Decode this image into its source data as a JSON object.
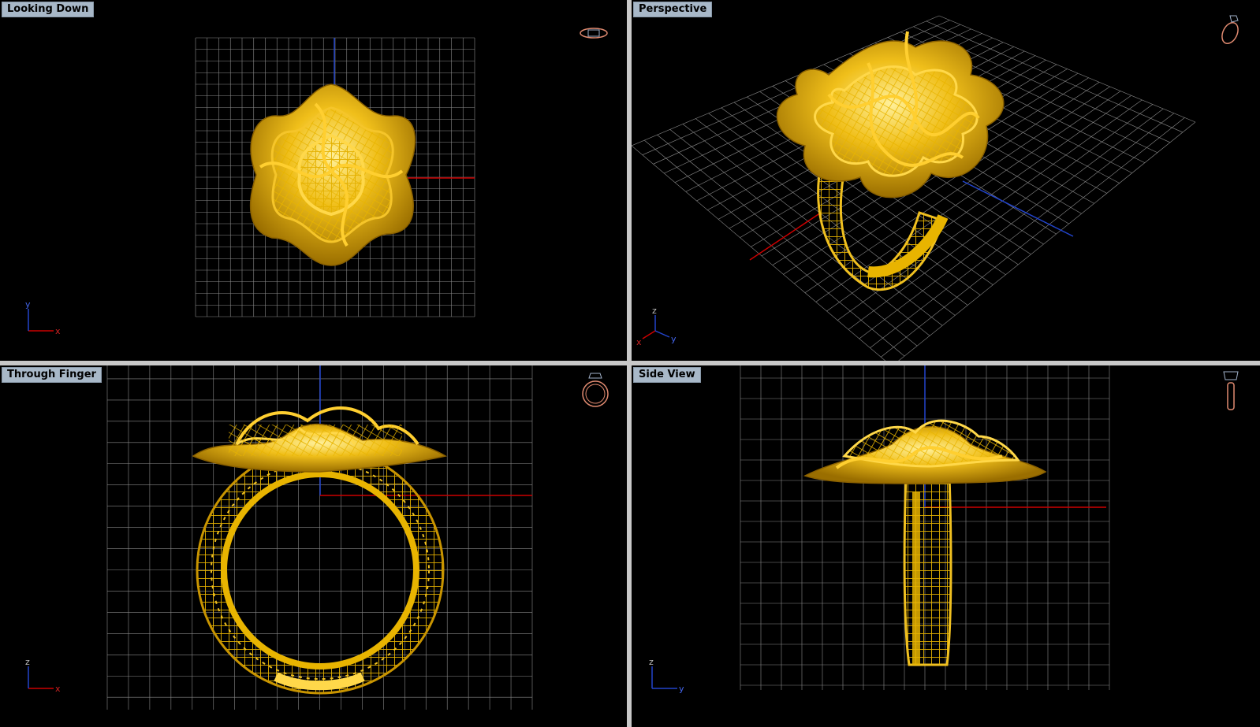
{
  "viewports": [
    {
      "id": "top",
      "title": "Looking Down",
      "axis_x": "x",
      "axis_y": "y",
      "icon": "ring-top-view-icon"
    },
    {
      "id": "perspective",
      "title": "Perspective",
      "axis_x": "y",
      "axis_y": "z",
      "axis_third": "x",
      "icon": "ring-perspective-icon"
    },
    {
      "id": "front",
      "title": "Through Finger",
      "axis_x": "x",
      "axis_y": "z",
      "icon": "ring-front-view-icon"
    },
    {
      "id": "side",
      "title": "Side View",
      "axis_x": "y",
      "axis_y": "z",
      "icon": "ring-side-view-icon"
    }
  ],
  "colors": {
    "background": "#000000",
    "grid": "#8a8a8a",
    "gold": "#e8b400",
    "gold_light": "#ffd84a",
    "gold_dark": "#9a6e00",
    "x_axis": "#cc0000",
    "y_axis": "#2244cc",
    "z_axis": "#2244cc",
    "title_bg": "#a8b8c8"
  }
}
